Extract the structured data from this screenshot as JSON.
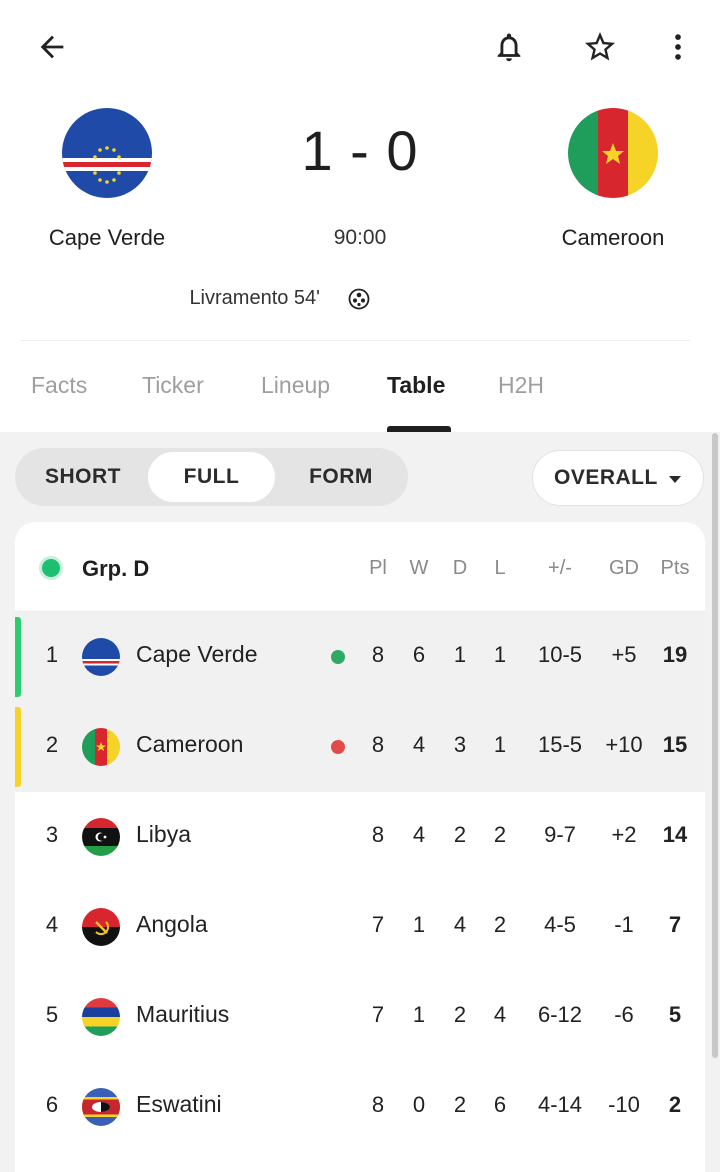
{
  "match": {
    "home": {
      "name": "Cape Verde"
    },
    "away": {
      "name": "Cameroon"
    },
    "score": "1 - 0",
    "clock": "90:00",
    "scorer": "Livramento 54'"
  },
  "toolbar": {
    "icons": [
      "back-arrow-icon",
      "bell-icon",
      "star-icon",
      "more-vert-icon"
    ]
  },
  "tabs": [
    "Facts",
    "Ticker",
    "Lineup",
    "Table",
    "H2H"
  ],
  "active_tab": "Table",
  "table_controls": {
    "views": [
      "SHORT",
      "FULL",
      "FORM"
    ],
    "active_view": "FULL",
    "filter": "OVERALL"
  },
  "group": {
    "title": "Grp. D",
    "headers": {
      "pl": "Pl",
      "w": "W",
      "d": "D",
      "l": "L",
      "goals": "+/-",
      "gd": "GD",
      "pts": "Pts"
    },
    "rows": [
      {
        "pos": "1",
        "team": "Cape Verde",
        "pl": "8",
        "w": "6",
        "d": "1",
        "l": "1",
        "goals": "10-5",
        "gd": "+5",
        "pts": "19"
      },
      {
        "pos": "2",
        "team": "Cameroon",
        "pl": "8",
        "w": "4",
        "d": "3",
        "l": "1",
        "goals": "15-5",
        "gd": "+10",
        "pts": "15"
      },
      {
        "pos": "3",
        "team": "Libya",
        "pl": "8",
        "w": "4",
        "d": "2",
        "l": "2",
        "goals": "9-7",
        "gd": "+2",
        "pts": "14"
      },
      {
        "pos": "4",
        "team": "Angola",
        "pl": "7",
        "w": "1",
        "d": "4",
        "l": "2",
        "goals": "4-5",
        "gd": "-1",
        "pts": "7"
      },
      {
        "pos": "5",
        "team": "Mauritius",
        "pl": "7",
        "w": "1",
        "d": "2",
        "l": "4",
        "goals": "6-12",
        "gd": "-6",
        "pts": "5"
      },
      {
        "pos": "6",
        "team": "Eswatini",
        "pl": "8",
        "w": "0",
        "d": "2",
        "l": "6",
        "goals": "4-14",
        "gd": "-10",
        "pts": "2"
      }
    ]
  },
  "colors": {
    "qualified": "#2ecc71",
    "playoff": "#f5d327",
    "winning_dot": "#2eaa62",
    "losing_dot": "#e24b4b",
    "group_dot": "#1fbf72"
  }
}
